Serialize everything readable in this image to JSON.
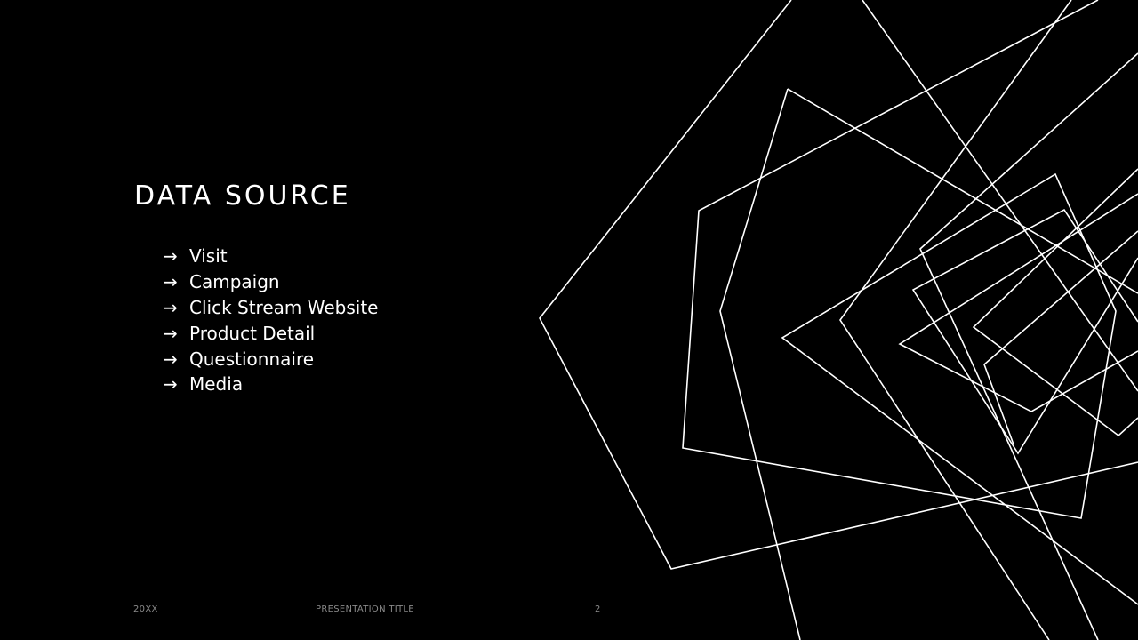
{
  "slide": {
    "title": "DATA SOURCE",
    "bullet_icon": "arrow-right-icon",
    "bullet_glyph": "→",
    "bullets": [
      "Visit",
      "Campaign",
      "Click Stream Website",
      "Product Detail",
      "Questionnaire",
      "Media"
    ]
  },
  "footer": {
    "date": "20XX",
    "presentation_title": "PRESENTATION TITLE",
    "page_number": "2"
  },
  "colors": {
    "background": "#000000",
    "text": "#ffffff",
    "footer_text": "#8a8a8a",
    "line_art": "#ffffff"
  }
}
